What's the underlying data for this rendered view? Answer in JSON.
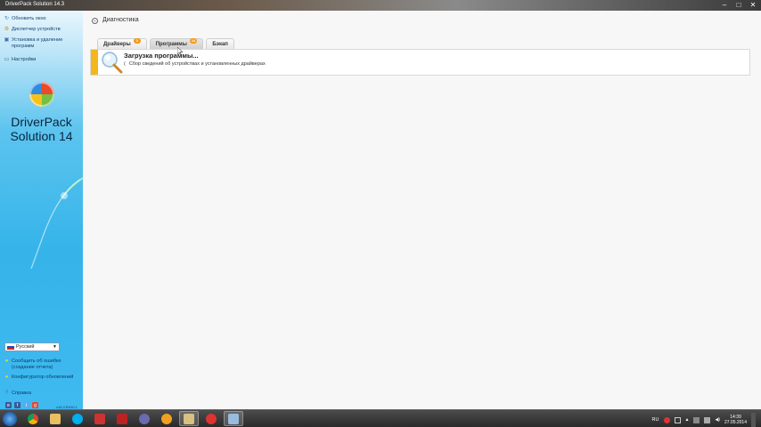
{
  "window": {
    "title": "DriverPack Solution 14.3",
    "controls": [
      "–",
      "□",
      "✕"
    ]
  },
  "sidebar": {
    "items": [
      {
        "label": "Обновить окно",
        "icon": "refresh-icon"
      },
      {
        "label": "Диспетчер устройств",
        "icon": "device-manager-icon"
      },
      {
        "label": "Установка и удаление программ",
        "icon": "programs-icon"
      },
      {
        "label": "Настройки",
        "icon": "settings-icon"
      }
    ],
    "logo_line1": "DriverPack",
    "logo_line2": "Solution 14",
    "language": "Русский",
    "bottom_items": [
      {
        "label": "Сообщить об ошибке (создание отчета)",
        "icon": "bug-report-icon"
      },
      {
        "label": "Конфигуратор обновлений",
        "icon": "update-config-icon"
      },
      {
        "label": "Справка",
        "icon": "help-icon"
      }
    ],
    "version": "v14.3 R410.1"
  },
  "main": {
    "section_title": "Диагностика",
    "tabs": [
      {
        "label": "Драйверы",
        "badge": "3"
      },
      {
        "label": "Программы",
        "badge": "14"
      },
      {
        "label": "Бэкап",
        "badge": ""
      }
    ],
    "loading": {
      "title": "Загрузка программы...",
      "subtitle": "Сбор сведений об устройствах и установленных драйверах"
    }
  },
  "taskbar": {
    "language": "RU",
    "time": "14:39",
    "date": "27.05.2014"
  },
  "colors": {
    "accent": "#f3b61c",
    "badge": "#f39a18",
    "sidebar": "#35b4ea"
  }
}
